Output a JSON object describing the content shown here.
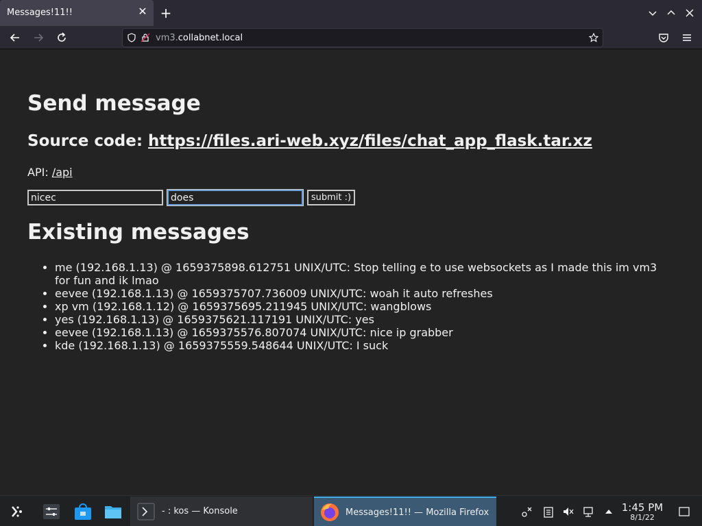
{
  "browser": {
    "tab_title": "Messages!11!!",
    "url_host": "vm3.",
    "url_domain": "collabnet.local"
  },
  "page": {
    "heading": "Send message",
    "source_label": "Source code: ",
    "source_link": "https://files.ari-web.xyz/files/chat_app_flask.tar.xz",
    "api_label": "API: ",
    "api_link": "/api",
    "input1_value": "nicec",
    "input2_value": "does",
    "submit_label": "submit :)",
    "existing_heading": "Existing messages",
    "messages": [
      "me (192.168.1.13) @ 1659375898.612751 UNIX/UTC: Stop telling e to use websockets as I made this im vm3 for fun and ik lmao",
      "eevee (192.168.1.13) @ 1659375707.736009 UNIX/UTC: woah it auto refreshes",
      "xp vm (192.168.1.12) @ 1659375695.211945 UNIX/UTC: wangblows",
      "yes (192.168.1.13) @ 1659375621.117191 UNIX/UTC: yes",
      "eevee (192.168.1.13) @ 1659375576.807074 UNIX/UTC: nice ip grabber",
      "kde (192.168.1.13) @ 1659375559.548644 UNIX/UTC: I suck"
    ]
  },
  "taskbar": {
    "task1": "- : kos — Konsole",
    "task2": "Messages!11!! — Mozilla Firefox",
    "time": "1:45 PM",
    "date": "8/1/22"
  },
  "colors": {
    "accent": "#3daee9",
    "page_bg": "#232323",
    "chrome_bg": "#2b2a33"
  }
}
